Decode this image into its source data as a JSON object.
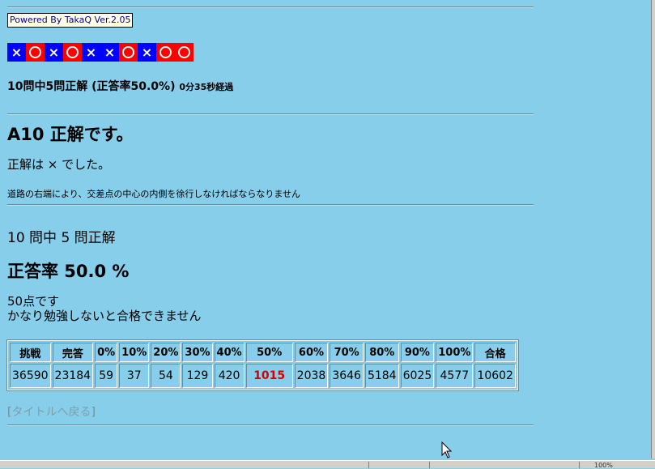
{
  "header": {
    "powered_by": "Powered By TakaQ Ver.2.05"
  },
  "marks": [
    "×",
    "○",
    "×",
    "○",
    "×",
    "×",
    "○",
    "×",
    "○",
    "○"
  ],
  "summary": {
    "main": "10問中5問正解 (正答率50.0%)",
    "elapsed": "0分35秒経過"
  },
  "answer": {
    "title": "A10 正解です。",
    "line": "正解は × でした。",
    "explanation": "道路の右端により、交差点の中心の内側を徐行しなければならなりません"
  },
  "result": {
    "count": "10 問中 5 問正解",
    "rate": "正答率 50.0 %",
    "score": "50点です",
    "comment": "かなり勉強しないと合格できません"
  },
  "stats": {
    "headers": [
      "挑戦",
      "完答",
      "0%",
      "10%",
      "20%",
      "30%",
      "40%",
      "50%",
      "60%",
      "70%",
      "80%",
      "90%",
      "100%",
      "合格"
    ],
    "values": [
      "36590",
      "23184",
      "59",
      "37",
      "54",
      "129",
      "420",
      "1015",
      "2038",
      "3646",
      "5184",
      "6025",
      "4577",
      "10602"
    ],
    "highlight_column": "50%"
  },
  "back_link": {
    "bracket_open": "[",
    "label": "タイトルへ戻る",
    "bracket_close": "]"
  },
  "status_bar": {
    "zoom": "100%"
  },
  "colors": {
    "background": "#87ceeb",
    "mark_x": "#0000ff",
    "mark_o": "#ff0000",
    "highlight": "#d40000"
  }
}
